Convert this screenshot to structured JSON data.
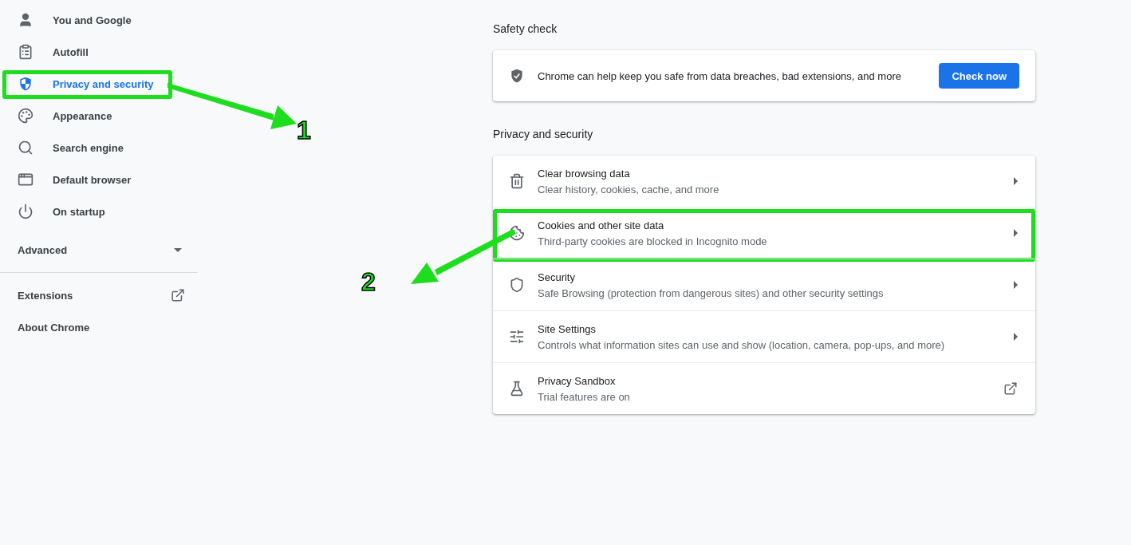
{
  "sidebar": {
    "items": [
      {
        "kind": "page",
        "label": "You and Google",
        "selected": false,
        "highlighted": false
      },
      {
        "kind": "page",
        "label": "Autofill",
        "selected": false,
        "highlighted": false
      },
      {
        "kind": "page",
        "label": "Privacy and security",
        "selected": true,
        "highlighted": true
      },
      {
        "kind": "page",
        "label": "Appearance",
        "selected": false,
        "highlighted": false
      },
      {
        "kind": "page",
        "label": "Search engine",
        "selected": false,
        "highlighted": false
      },
      {
        "kind": "page",
        "label": "Default browser",
        "selected": false,
        "highlighted": false
      },
      {
        "kind": "page",
        "label": "On startup",
        "selected": false,
        "highlighted": false
      },
      {
        "kind": "section",
        "label": "Advanced",
        "expanded": false
      },
      {
        "kind": "divider"
      },
      {
        "kind": "external",
        "label": "Extensions"
      },
      {
        "kind": "plain",
        "label": "About Chrome"
      }
    ]
  },
  "safety_check": {
    "title": "Safety check",
    "text": "Chrome can help keep you safe from data breaches, bad extensions, and more",
    "button": "Check now"
  },
  "privacy": {
    "title": "Privacy and security",
    "rows": [
      {
        "kind": "subpage",
        "title": "Clear browsing data",
        "subtitle": "Clear history, cookies, cache, and more",
        "highlighted": false
      },
      {
        "kind": "subpage",
        "title": "Cookies and other site data",
        "subtitle": "Third-party cookies are blocked in Incognito mode",
        "highlighted": true
      },
      {
        "kind": "subpage",
        "title": "Security",
        "subtitle": "Safe Browsing (protection from dangerous sites) and other security settings",
        "highlighted": false
      },
      {
        "kind": "subpage",
        "title": "Site Settings",
        "subtitle": "Controls what information sites can use and show (location, camera, pop-ups, and more)",
        "highlighted": false
      },
      {
        "kind": "external",
        "title": "Privacy Sandbox",
        "subtitle": "Trial features are on",
        "highlighted": false
      }
    ]
  },
  "annotations": [
    {
      "kind": "arrow-callout",
      "label": "1"
    },
    {
      "kind": "arrow-callout",
      "label": "2"
    }
  ]
}
